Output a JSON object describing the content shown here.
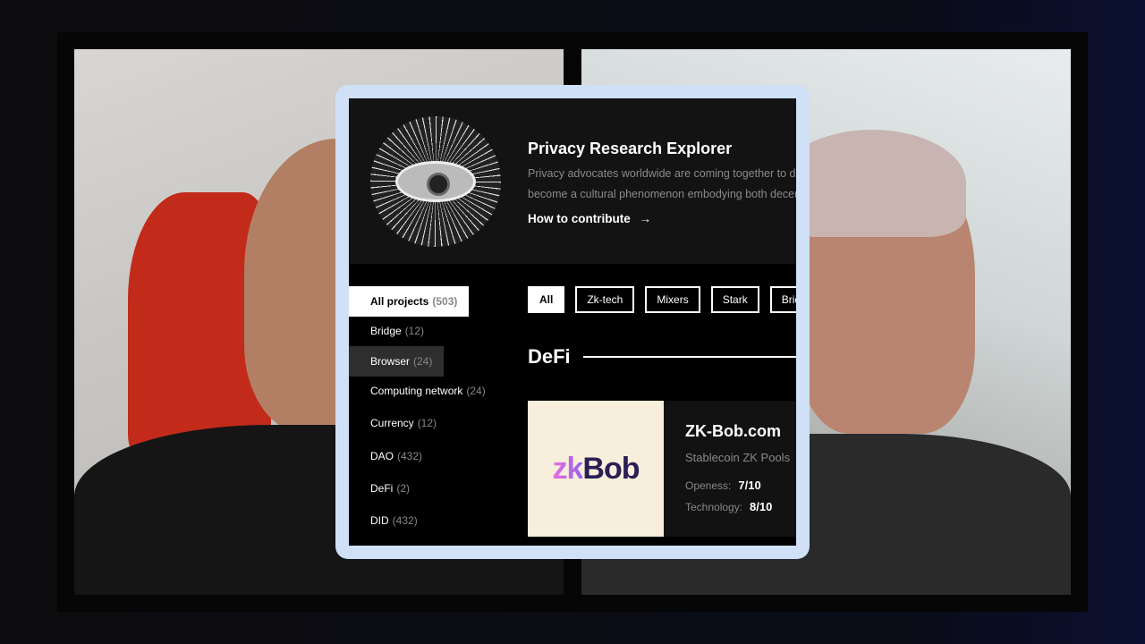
{
  "header": {
    "title": "Privacy Research Explorer",
    "description_line1": "Privacy advocates worldwide are coming together to dis",
    "description_line2": "become a cultural phenomenon embodying both decent",
    "contribute_link": "How to contribute",
    "arrow": "→"
  },
  "sidebar": {
    "items": [
      {
        "label": "All projects",
        "count": "(503)",
        "state": "active"
      },
      {
        "label": "Bridge",
        "count": "(12)"
      },
      {
        "label": "Browser",
        "count": "(24)",
        "state": "hover"
      },
      {
        "label": "Computing network",
        "count": "(24)"
      },
      {
        "label": "Currency",
        "count": "(12)"
      },
      {
        "label": "DAO",
        "count": "(432)"
      },
      {
        "label": "DeFi",
        "count": "(2)"
      },
      {
        "label": "DID",
        "count": "(432)"
      }
    ]
  },
  "filters": [
    "All",
    "Zk-tech",
    "Mixers",
    "Stark",
    "Brid"
  ],
  "section": {
    "title": "DeFi"
  },
  "project": {
    "logo_zk": "zk",
    "logo_bob": "Bob",
    "name": "ZK-Bob.com",
    "subtitle": "Stablecoin ZK Pools",
    "openness_label": "Openess:",
    "openness_value": "7/10",
    "technology_label": "Technology:",
    "technology_value": "8/10"
  },
  "colors": {
    "card_border": "#cfe0f7",
    "background": "#000000",
    "header_bg": "#131313"
  }
}
